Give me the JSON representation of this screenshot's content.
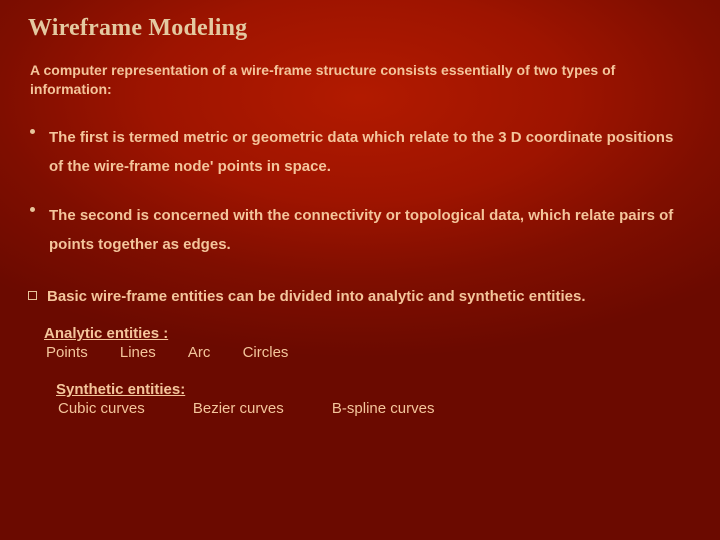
{
  "title": "Wireframe Modeling",
  "intro": "A computer representation of a wire-frame structure consists essentially of two types of information:",
  "bullets": [
    "The first is termed metric or geometric data which relate to the 3 D coordinate positions of the wire-frame node' points in space.",
    "The second is concerned with the connectivity or topological data, which relate pairs of points together as edges."
  ],
  "square_bullet": "Basic wire-frame entities can be divided into analytic and synthetic entities.",
  "analytic": {
    "heading": "Analytic entities :",
    "items": [
      "Points",
      "Lines",
      "Arc",
      "Circles"
    ]
  },
  "synthetic": {
    "heading": "Synthetic entities:",
    "items": [
      "Cubic curves",
      "Bezier curves",
      "B-spline curves"
    ]
  }
}
